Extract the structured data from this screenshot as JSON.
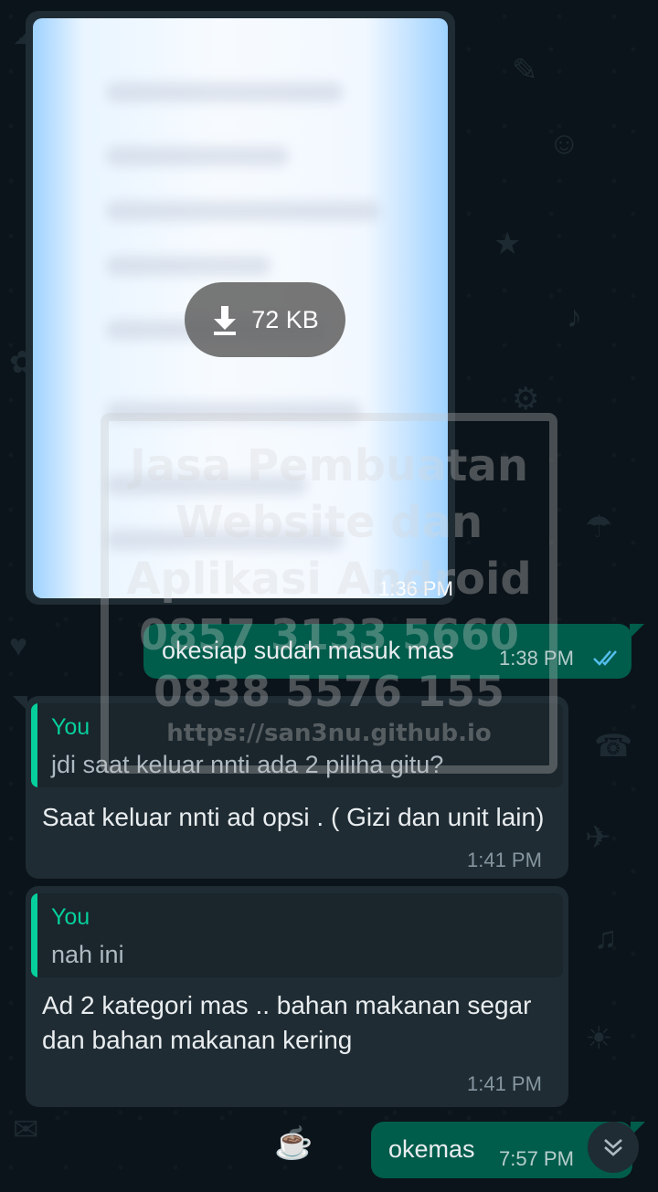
{
  "messages": {
    "image": {
      "download_size": "72 KB",
      "time": "1:36 PM",
      "download_icon": "download-arrow-icon"
    },
    "out1": {
      "text": "okesiap sudah masuk mas",
      "time": "1:38 PM",
      "status_icon": "double-check-icon"
    },
    "in1": {
      "quote_author": "You",
      "quote_text": "jdi saat keluar nnti ada 2 piliha gitu?",
      "text": "Saat keluar nnti ad opsi . ( Gizi dan unit lain)",
      "time": "1:41 PM"
    },
    "in2": {
      "quote_author": "You",
      "quote_text": "nah ini",
      "text": "Ad 2 kategori mas .. bahan makanan segar dan bahan makanan kering",
      "time": "1:41 PM"
    },
    "out2": {
      "text": "okemas",
      "time": "7:57 PM"
    }
  },
  "watermark": {
    "line1": "Jasa Pembuatan",
    "line2": "Website dan",
    "line3": "Aplikasi Android",
    "line4": "0857 3133 5660",
    "line5": "0838 5576 155",
    "line6": "https://san3nu.github.io"
  },
  "scroll_button_icon": "chevron-double-down-icon",
  "colors": {
    "background": "#0b141a",
    "incoming_bubble": "#1f2c34",
    "outgoing_bubble": "#005c4b",
    "accent": "#06cf9c",
    "read_receipt": "#53bdeb"
  }
}
